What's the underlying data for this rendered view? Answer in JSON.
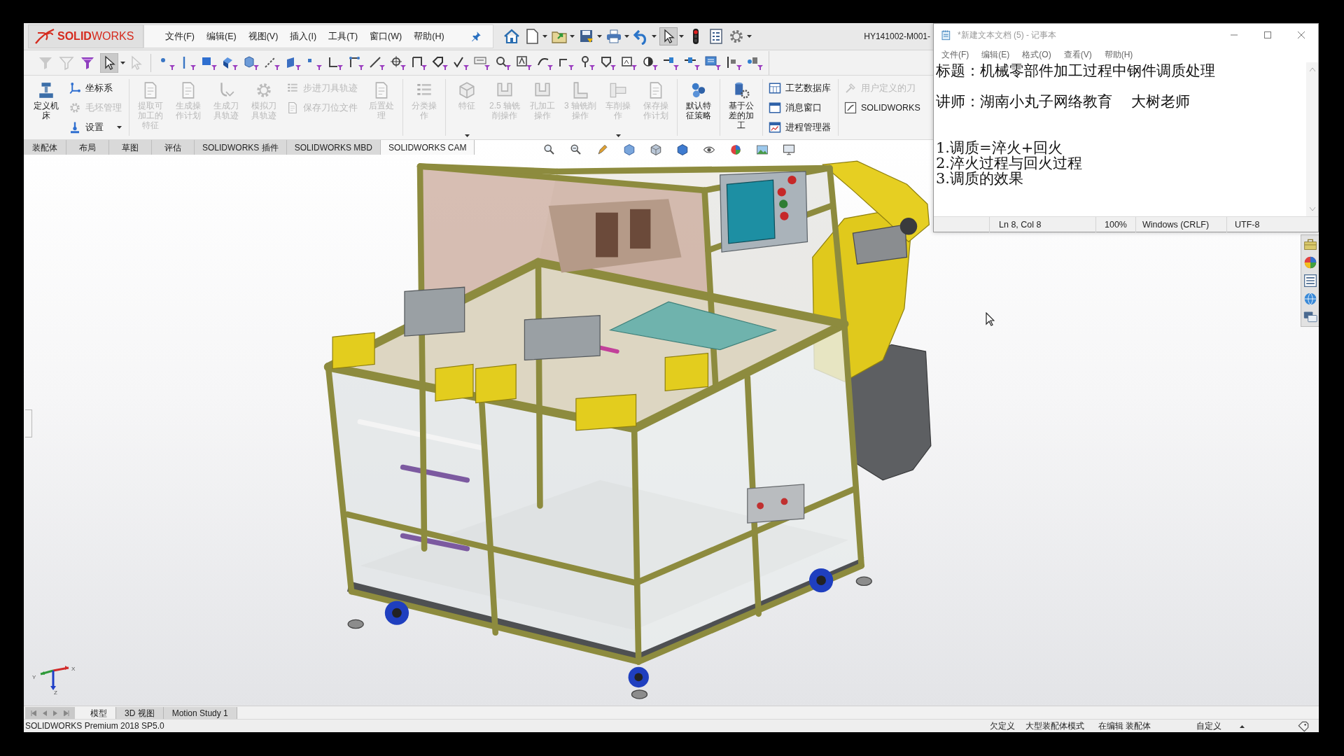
{
  "solidworks": {
    "logo": "**SOLID**WORKS",
    "menu": [
      "文件(F)",
      "编辑(E)",
      "视图(V)",
      "插入(I)",
      "工具(T)",
      "窗口(W)",
      "帮助(H)"
    ],
    "quick_access": {
      "select_pressed": true
    },
    "document_title": "HY141002-M001-",
    "filter_toolbar": {
      "select_pressed": true
    },
    "ribbon": [
      {
        "items": [
          {
            "kind": "large",
            "label": "定义机床",
            "disabled": false,
            "dropdown": false
          },
          {
            "kind": "stack",
            "items": [
              {
                "label": "坐标系",
                "disabled": false,
                "dropdown": false
              },
              {
                "label": "毛坯管理",
                "disabled": true,
                "dropdown": false
              },
              {
                "label": "设置",
                "disabled": false,
                "dropdown": true
              }
            ]
          }
        ]
      },
      {
        "items": [
          {
            "kind": "large",
            "label": "提取可加工的特征",
            "disabled": true,
            "dropdown": false
          },
          {
            "kind": "large",
            "label": "生成操作计划",
            "disabled": true,
            "dropdown": false
          },
          {
            "kind": "large",
            "label": "生成刀具轨迹",
            "disabled": true,
            "dropdown": false
          },
          {
            "kind": "large",
            "label": "模拟刀具轨迹",
            "disabled": true,
            "dropdown": false
          },
          {
            "kind": "stack",
            "items": [
              {
                "label": "步进刀具轨迹",
                "disabled": true,
                "dropdown": false
              },
              {
                "label": "保存刀位文件",
                "disabled": true,
                "dropdown": false
              }
            ]
          },
          {
            "kind": "large",
            "label": "后置处理",
            "disabled": true,
            "dropdown": false
          }
        ]
      },
      {
        "items": [
          {
            "kind": "large",
            "label": "分类操作",
            "disabled": true,
            "dropdown": false
          }
        ]
      },
      {
        "items": [
          {
            "kind": "large",
            "label": "特征",
            "disabled": true,
            "dropdown": true
          },
          {
            "kind": "large",
            "label": "2.5 轴铣削操作",
            "disabled": true,
            "dropdown": false
          },
          {
            "kind": "large",
            "label": "孔加工操作",
            "disabled": true,
            "dropdown": false
          },
          {
            "kind": "large",
            "label": "3 轴铣削操作",
            "disabled": true,
            "dropdown": false
          },
          {
            "kind": "large",
            "label": "车削操作",
            "disabled": true,
            "dropdown": true
          },
          {
            "kind": "large",
            "label": "保存操作计划",
            "disabled": true,
            "dropdown": false
          }
        ]
      },
      {
        "items": [
          {
            "kind": "large",
            "label": "默认特征策略",
            "disabled": false,
            "dropdown": false
          }
        ]
      },
      {
        "items": [
          {
            "kind": "large",
            "label": "基于公差的加工",
            "disabled": false,
            "dropdown": false
          }
        ]
      },
      {
        "items": [
          {
            "kind": "stack",
            "items": [
              {
                "label": "工艺数据库",
                "disabled": false,
                "dropdown": false
              },
              {
                "label": "消息窗口",
                "disabled": false,
                "dropdown": false
              },
              {
                "label": "进程管理器",
                "disabled": false,
                "dropdown": false
              }
            ]
          }
        ]
      },
      {
        "items": [
          {
            "kind": "stack",
            "items": [
              {
                "label": "用户定义的刀",
                "disabled": true,
                "dropdown": false
              },
              {
                "label": "SOLIDWORKS",
                "disabled": false,
                "dropdown": false
              }
            ]
          }
        ]
      }
    ],
    "tabs": [
      {
        "label": "装配体",
        "selected": false
      },
      {
        "label": "布局",
        "selected": false
      },
      {
        "label": "草图",
        "selected": false
      },
      {
        "label": "评估",
        "selected": false
      },
      {
        "label": "SOLIDWORKS 插件",
        "selected": false
      },
      {
        "label": "SOLIDWORKS MBD",
        "selected": false
      },
      {
        "label": "SOLIDWORKS CAM",
        "selected": true
      }
    ],
    "triad_labels": [
      "Y",
      "X",
      "Z"
    ],
    "bottom_tabs": [
      {
        "label": "模型",
        "selected": true
      },
      {
        "label": "3D 视图",
        "selected": false
      },
      {
        "label": "Motion Study 1",
        "selected": false
      }
    ],
    "status": {
      "product": "SOLIDWORKS Premium 2018 SP5.0",
      "fields": [
        "欠定义",
        "大型装配体模式",
        "在编辑 装配体",
        "自定义"
      ]
    }
  },
  "notepad": {
    "title": "*新建文本文档 (5) - 记事本",
    "menu": [
      "文件(F)",
      "编辑(E)",
      "格式(O)",
      "查看(V)",
      "帮助(H)"
    ],
    "lines": [
      {
        "kind": "text",
        "text": "标题：机械零部件加工过程中钢件调质处理"
      },
      {
        "kind": "blank"
      },
      {
        "kind": "text",
        "text": "讲师：湖南小丸子网络教育    大树老师"
      },
      {
        "kind": "blank"
      },
      {
        "kind": "blank"
      },
      {
        "kind": "text",
        "text": "1.调质=淬火+回火"
      },
      {
        "kind": "text",
        "text": "2.淬火过程与回火过程"
      },
      {
        "kind": "text",
        "text": "3.调质的效果"
      }
    ],
    "status": [
      "Ln 8, Col 8",
      "100%",
      "Windows (CRLF)",
      "UTF-8"
    ]
  }
}
